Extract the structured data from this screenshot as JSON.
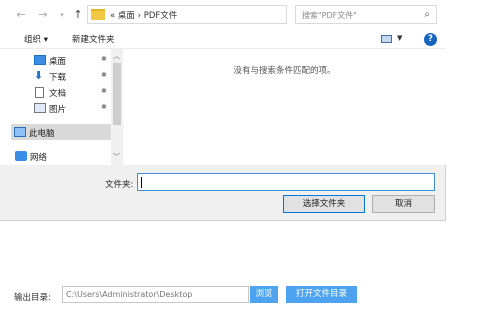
{
  "address": {
    "path": "« 桌面 › PDF文件",
    "search_placeholder": "搜索\"PDF文件\""
  },
  "toolbar": {
    "organize": "组织 ▾",
    "new_folder": "新建文件夹"
  },
  "nav": {
    "items": [
      {
        "label": "桌面",
        "pinned": true
      },
      {
        "label": "下载",
        "pinned": true
      },
      {
        "label": "文档",
        "pinned": true
      },
      {
        "label": "图片",
        "pinned": true
      },
      {
        "label": "此电脑",
        "pinned": false
      },
      {
        "label": "网络",
        "pinned": false
      }
    ]
  },
  "main": {
    "empty_message": "没有与搜索条件匹配的项。"
  },
  "footer": {
    "filename_label": "文件夹:",
    "filename_value": "",
    "select_button": "选择文件夹",
    "cancel_button": "取消"
  },
  "outer": {
    "output_label": "输出目录:",
    "output_path": "C:\\Users\\Administrator\\Desktop",
    "browse_button": "浏览",
    "open_folder_button": "打开文件目录"
  }
}
